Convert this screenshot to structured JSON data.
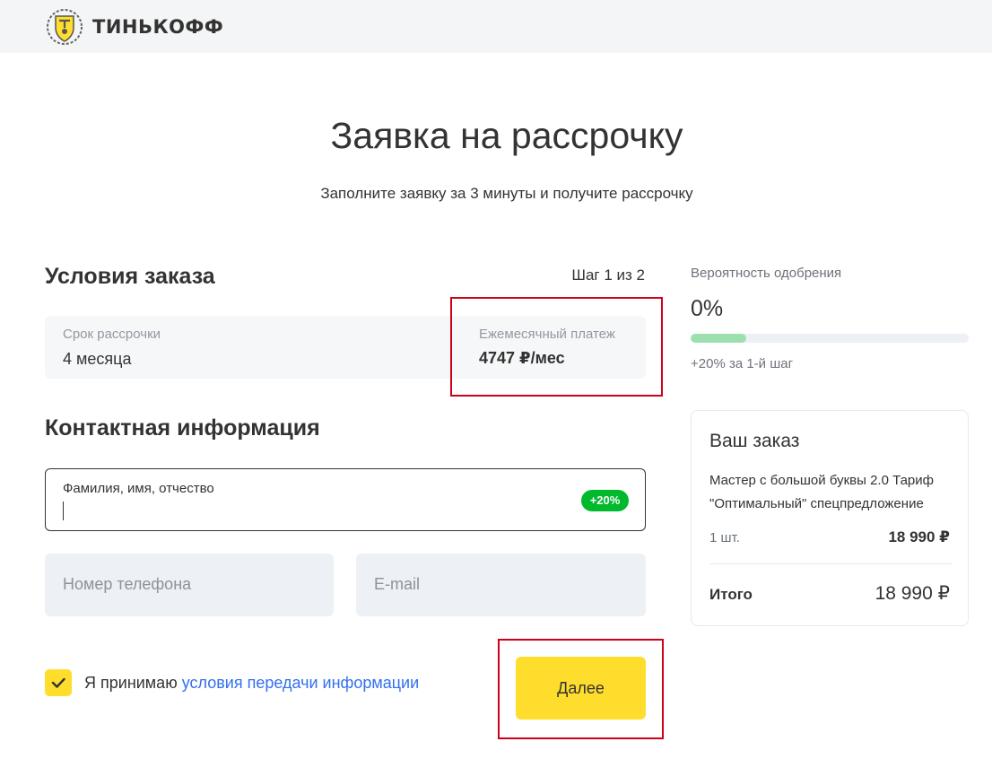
{
  "brand": {
    "name": "ТИНЬКОФФ",
    "accent": "#ffdd2d"
  },
  "page": {
    "title": "Заявка на рассрочку",
    "subtitle": "Заполните заявку за 3 минуты и получите рассрочку"
  },
  "order_conditions": {
    "title": "Условия заказа",
    "step": "Шаг 1 из 2",
    "term_label": "Срок рассрочки",
    "term_value": "4 месяца",
    "payment_label": "Ежемесячный платеж",
    "payment_value": "4747 ₽/мес"
  },
  "contact": {
    "title": "Контактная информация",
    "fio_label": "Фамилия, имя, отчество",
    "fio_value": "",
    "fio_badge": "+20%",
    "phone_placeholder": "Номер телефона",
    "email_placeholder": "E-mail"
  },
  "consent": {
    "checked": true,
    "text": "Я принимаю",
    "link": "условия передачи информации"
  },
  "actions": {
    "next_label": "Далее"
  },
  "approval": {
    "label": "Вероятность одобрения",
    "value": "0%",
    "progress_fraction": 0.2,
    "hint": "+20% за 1-й шаг"
  },
  "order": {
    "title": "Ваш заказ",
    "product": "Мастер с большой буквы 2.0 Тариф \"Оптимальный\" спецпредложение",
    "qty": "1 шт.",
    "price": "18 990 ₽",
    "total_label": "Итого",
    "total_value": "18 990 ₽"
  }
}
